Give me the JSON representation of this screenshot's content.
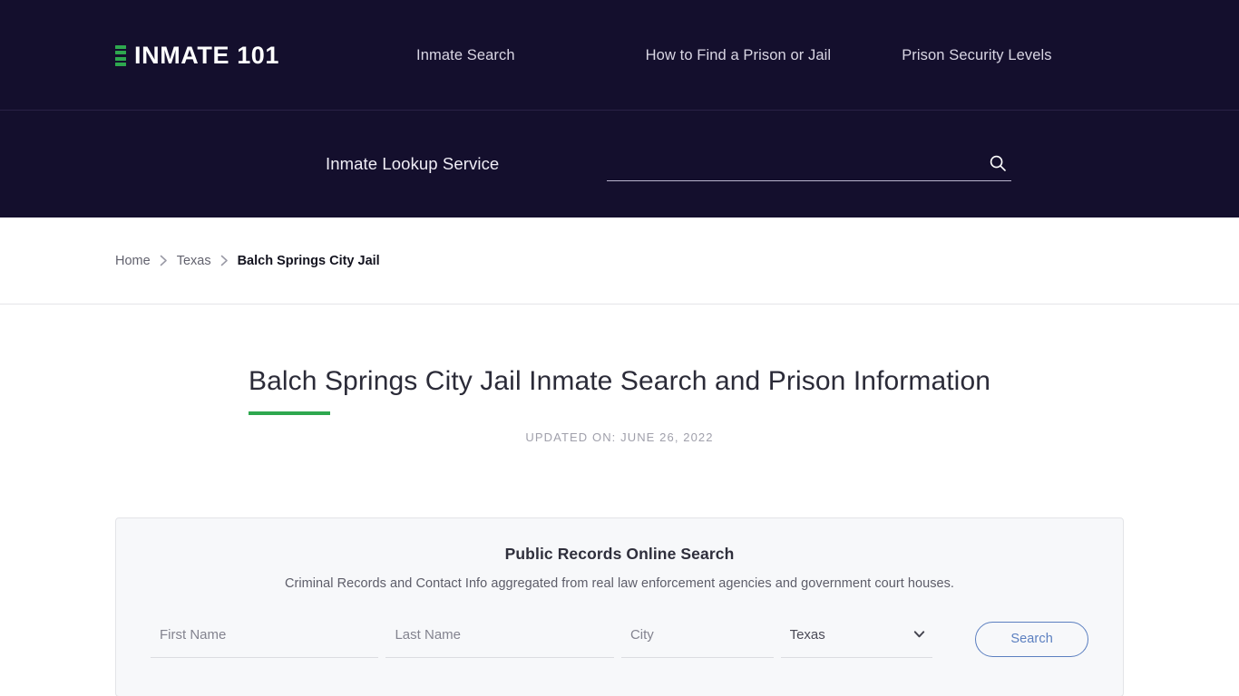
{
  "header": {
    "brand": {
      "name": "INMATE 101",
      "mark_color": "#2ea84f",
      "bar_count": 4
    },
    "nav": [
      {
        "label": "Inmate Search"
      },
      {
        "label": "How to Find a Prison or Jail"
      },
      {
        "label": "Prison Security Levels"
      }
    ],
    "search": {
      "label": "Inmate Lookup Service",
      "value": "",
      "placeholder": "",
      "icon": "search-icon"
    },
    "background_color": "#140f2d"
  },
  "breadcrumb": {
    "items": [
      {
        "label": "Home",
        "current": false
      },
      {
        "label": "Texas",
        "current": false
      },
      {
        "label": "Balch Springs City Jail",
        "current": true
      }
    ],
    "separator_icon": "chevron-right-icon"
  },
  "page": {
    "title": "Balch Springs City Jail Inmate Search and Prison Information",
    "accent_color": "#2ea84f",
    "updated": "UPDATED ON: JUNE 26, 2022"
  },
  "records_card": {
    "title": "Public Records Online Search",
    "subtitle": "Criminal Records and Contact Info aggregated from real law enforcement agencies and government court houses.",
    "fields": {
      "first_name": {
        "placeholder": "First Name",
        "value": ""
      },
      "last_name": {
        "placeholder": "Last Name",
        "value": ""
      },
      "city": {
        "placeholder": "City",
        "value": ""
      },
      "state": {
        "value": "Texas",
        "options": [
          "Texas"
        ],
        "icon": "chevron-down-icon"
      }
    },
    "submit_label": "Search",
    "submit_color": "#5b7fc0"
  }
}
